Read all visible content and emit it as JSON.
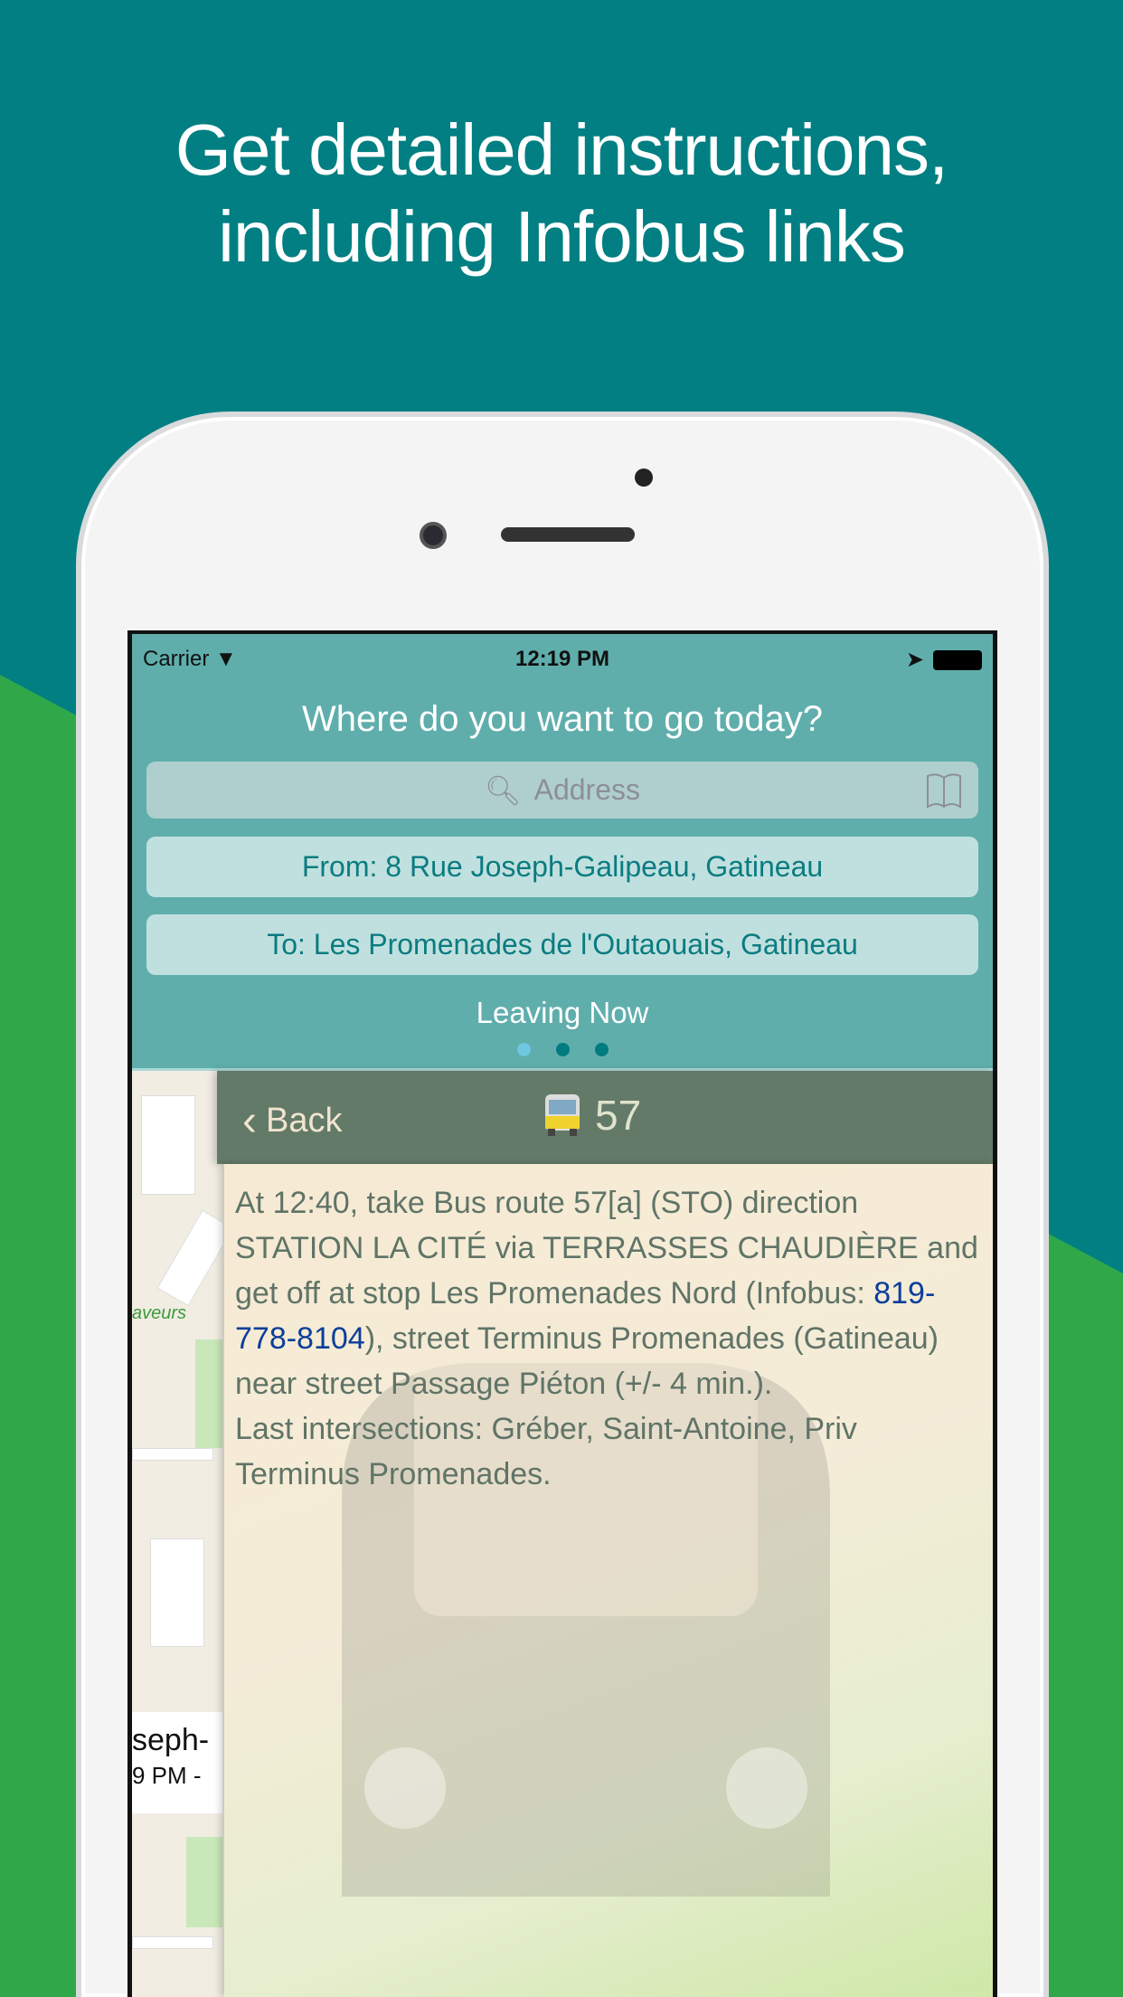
{
  "headline": [
    "Get detailed instructions,",
    "including Infobus links"
  ],
  "colors": {
    "teal": "#017f82",
    "green": "#30a849",
    "header": "#5faeac",
    "nav": "#637a68",
    "link": "#0b3f9a"
  },
  "status": {
    "carrier": "Carrier",
    "time": "12:19 PM"
  },
  "header": {
    "question": "Where do you want to go today?",
    "address_placeholder": "Address",
    "from": "From: 8 Rue Joseph-Galipeau, Gatineau",
    "to": "To: Les Promenades de l'Outaouais, Gatineau",
    "leaving": "Leaving Now",
    "page_dots": {
      "count": 3,
      "active": 0
    }
  },
  "nav": {
    "back": "Back",
    "route": "57",
    "icon": "bus-icon"
  },
  "instructions": {
    "part1": "At 12:40, take Bus route 57[a] (STO) direction STATION LA CITÉ via TERRASSES CHAUDIÈRE and get off at stop Les Promenades Nord (Infobus: ",
    "phone": "819-778-8104",
    "part2": "), street Terminus Promenades (Gatineau) near street Passage Piéton (+/- 4 min.).",
    "last": "Last intersections: Gréber, Saint-Antoine, Priv Terminus Promenades."
  },
  "map": {
    "label": "aveurs",
    "callout_title": "seph-",
    "callout_sub": "9 PM -"
  }
}
